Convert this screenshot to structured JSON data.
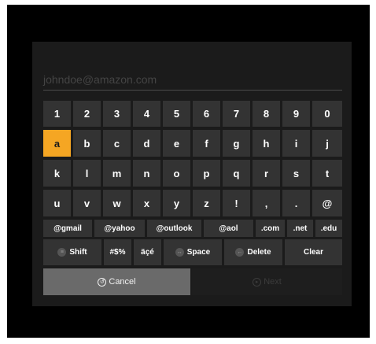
{
  "input": {
    "placeholder": "johndoe@amazon.com"
  },
  "keyboard": {
    "row1": [
      "1",
      "2",
      "3",
      "4",
      "5",
      "6",
      "7",
      "8",
      "9",
      "0"
    ],
    "row2": [
      "a",
      "b",
      "c",
      "d",
      "e",
      "f",
      "g",
      "h",
      "i",
      "j"
    ],
    "row3": [
      "k",
      "l",
      "m",
      "n",
      "o",
      "p",
      "q",
      "r",
      "s",
      "t"
    ],
    "row4": [
      "u",
      "v",
      "w",
      "x",
      "y",
      "z",
      "!",
      ",",
      ".",
      "@"
    ],
    "domains": [
      "@gmail",
      "@yahoo",
      "@outlook",
      "@aol",
      ".com",
      ".net",
      ".edu"
    ],
    "functions": {
      "shift": "Shift",
      "symbols": "#$%",
      "accents": "äçé",
      "space": "Space",
      "delete": "Delete",
      "clear": "Clear"
    },
    "selected_key": "a",
    "accent_color": "#f5a623"
  },
  "actions": {
    "cancel": "Cancel",
    "next": "Next"
  }
}
